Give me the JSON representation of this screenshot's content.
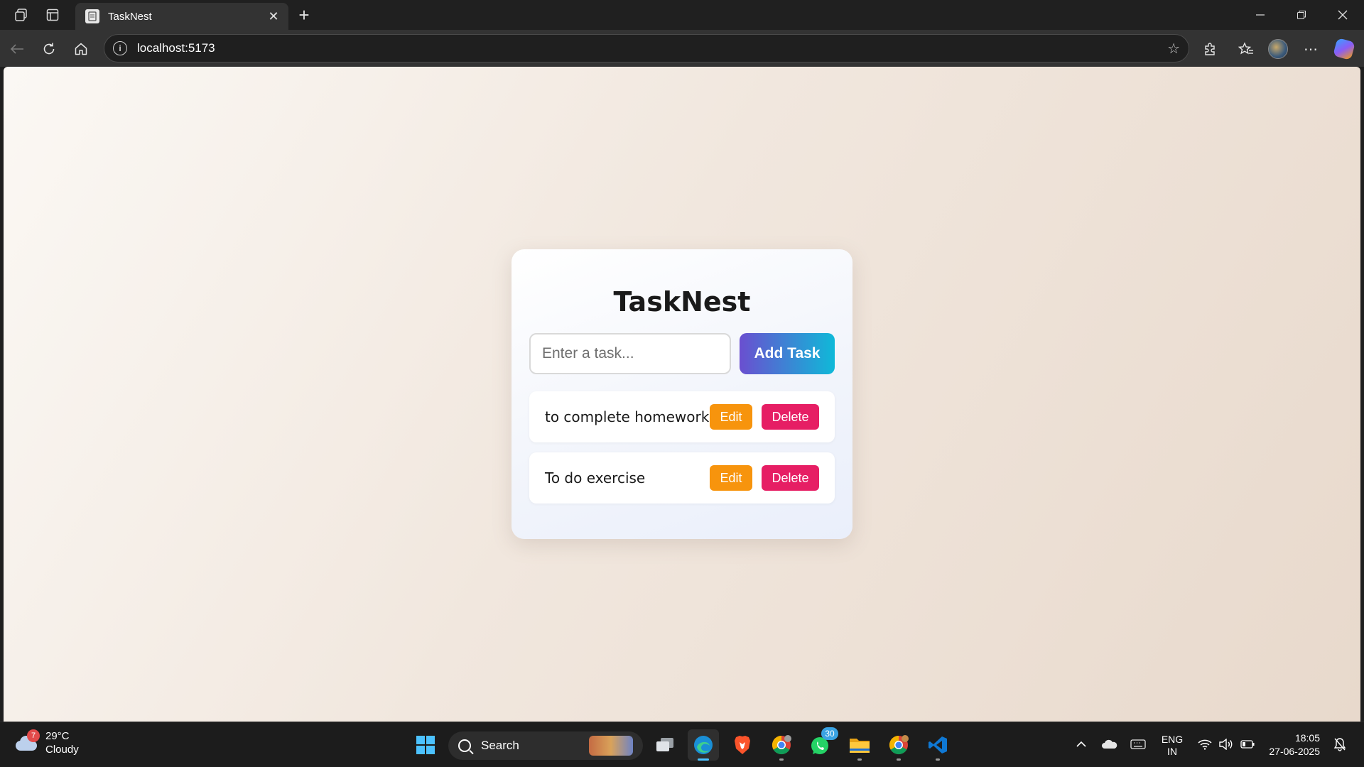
{
  "browser": {
    "tab_title": "TaskNest",
    "url": "localhost:5173"
  },
  "app": {
    "title": "TaskNest",
    "input_placeholder": "Enter a task...",
    "input_value": "",
    "add_label": "Add Task",
    "tasks": [
      {
        "text": "to complete homework",
        "edit_label": "Edit",
        "delete_label": "Delete"
      },
      {
        "text": "To do exercise",
        "edit_label": "Edit",
        "delete_label": "Delete"
      }
    ],
    "colors": {
      "add_gradient_start": "#6a4fd0",
      "add_gradient_end": "#0fb9d8",
      "edit": "#f7940d",
      "delete": "#e61e64"
    }
  },
  "taskbar": {
    "weather": {
      "badge": "7",
      "temp": "29°C",
      "condition": "Cloudy"
    },
    "search_label": "Search",
    "whatsapp_badge": "30",
    "language": {
      "line1": "ENG",
      "line2": "IN"
    },
    "clock": {
      "time": "18:05",
      "date": "27-06-2025"
    },
    "pinned": [
      "windows-start-icon",
      "search",
      "task-view-icon",
      "edge-icon",
      "brave-icon",
      "chrome-icon",
      "whatsapp-icon",
      "file-explorer-icon",
      "chrome-profile-icon",
      "vscode-icon"
    ]
  }
}
